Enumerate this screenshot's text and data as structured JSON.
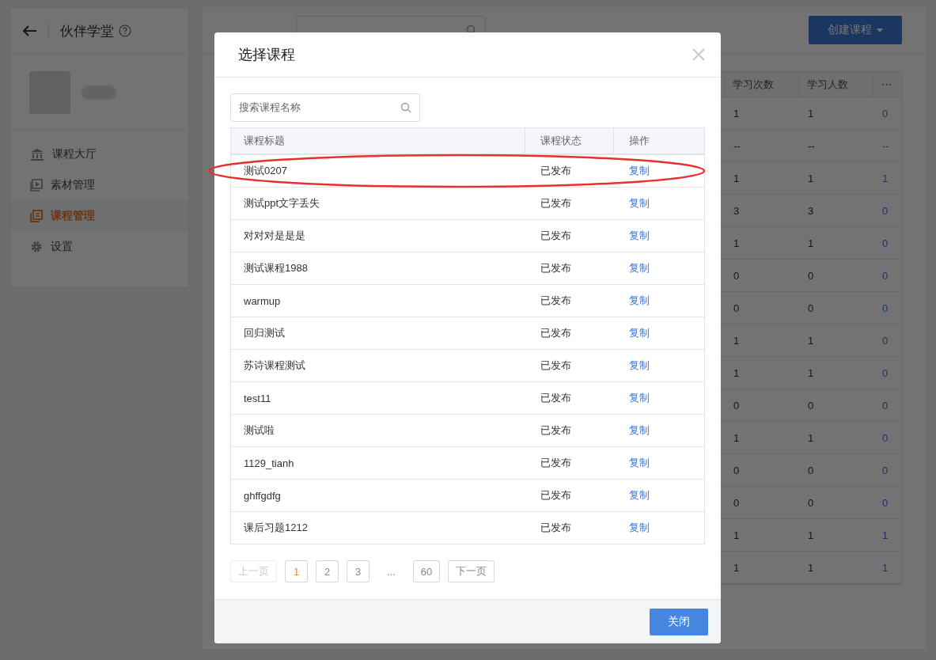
{
  "sidebar": {
    "title": "伙伴学堂",
    "items": [
      {
        "label": "课程大厅",
        "kind": "bank",
        "selected": false
      },
      {
        "label": "素材管理",
        "kind": "media",
        "selected": false
      },
      {
        "label": "课程管理",
        "kind": "book",
        "selected": true
      },
      {
        "label": "设置",
        "kind": "gear",
        "selected": false
      }
    ]
  },
  "main": {
    "create_button": "创建课程",
    "table": {
      "columns": [
        "学习次数",
        "学习人数",
        "⋯"
      ],
      "rows": [
        [
          "1",
          "1",
          "0"
        ],
        [
          "--",
          "--",
          "--"
        ],
        [
          "1",
          "1",
          "1"
        ],
        [
          "3",
          "3",
          "0"
        ],
        [
          "1",
          "1",
          "0"
        ],
        [
          "0",
          "0",
          "0"
        ],
        [
          "0",
          "0",
          "0"
        ],
        [
          "1",
          "1",
          "0"
        ],
        [
          "1",
          "1",
          "0"
        ],
        [
          "0",
          "0",
          "0"
        ],
        [
          "1",
          "1",
          "0"
        ],
        [
          "0",
          "0",
          "0"
        ],
        [
          "0",
          "0",
          "0"
        ],
        [
          "1",
          "1",
          "1"
        ],
        [
          "1",
          "1",
          "1"
        ]
      ]
    }
  },
  "dialog": {
    "title": "选择课程",
    "search": {
      "placeholder": "搜索课程名称"
    },
    "columns": [
      "课程标题",
      "课程状态",
      "操作"
    ],
    "rows": [
      {
        "title": "测试0207",
        "status": "已发布",
        "action": "复制",
        "highlighted": true
      },
      {
        "title": "测试ppt文字丢失",
        "status": "已发布",
        "action": "复制",
        "highlighted": false
      },
      {
        "title": "对对对是是是",
        "status": "已发布",
        "action": "复制",
        "highlighted": false
      },
      {
        "title": "测试课程1988",
        "status": "已发布",
        "action": "复制",
        "highlighted": false
      },
      {
        "title": "warmup",
        "status": "已发布",
        "action": "复制",
        "highlighted": false
      },
      {
        "title": "回归测试",
        "status": "已发布",
        "action": "复制",
        "highlighted": false
      },
      {
        "title": "苏诗课程测试",
        "status": "已发布",
        "action": "复制",
        "highlighted": false
      },
      {
        "title": "test11",
        "status": "已发布",
        "action": "复制",
        "highlighted": false
      },
      {
        "title": "测试啦",
        "status": "已发布",
        "action": "复制",
        "highlighted": false
      },
      {
        "title": "1129_tianh",
        "status": "已发布",
        "action": "复制",
        "highlighted": false
      },
      {
        "title": "ghffgdfg",
        "status": "已发布",
        "action": "复制",
        "highlighted": false
      },
      {
        "title": "课后习题1212",
        "status": "已发布",
        "action": "复制",
        "highlighted": false
      }
    ],
    "pagination": [
      {
        "kind": "prev",
        "label": "上一页",
        "disabled": true
      },
      {
        "kind": "page",
        "label": "1",
        "selected": true
      },
      {
        "kind": "page",
        "label": "2",
        "selected": false
      },
      {
        "kind": "page",
        "label": "3",
        "selected": false
      },
      {
        "kind": "ellipsis",
        "label": "..."
      },
      {
        "kind": "page",
        "label": "60",
        "selected": false
      },
      {
        "kind": "next",
        "label": "下一页",
        "disabled": false
      }
    ],
    "close_button": "关闭"
  }
}
